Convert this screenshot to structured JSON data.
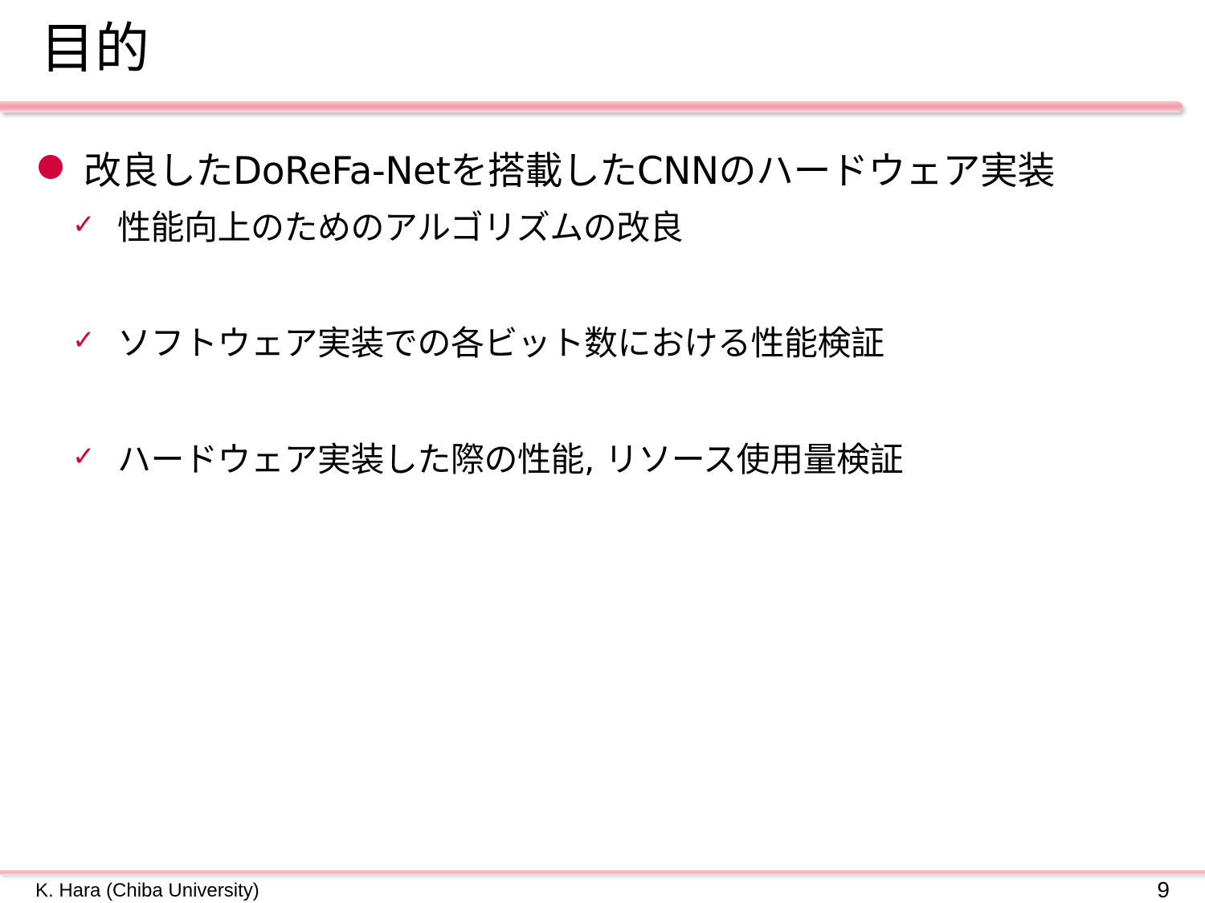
{
  "title": "目的",
  "colors": {
    "accent": "#d0043c",
    "rule": "#f19aa6"
  },
  "bullet": {
    "icon": "filled-circle-icon",
    "text": "改良したDoReFa-Netを搭載したCNNのハードウェア実装"
  },
  "subitems": [
    {
      "icon": "check-icon",
      "glyph": "✓",
      "text": "性能向上のためのアルゴリズムの改良"
    },
    {
      "icon": "check-icon",
      "glyph": "✓",
      "text": "ソフトウェア実装での各ビット数における性能検証"
    },
    {
      "icon": "check-icon",
      "glyph": "✓",
      "text": "ハードウェア実装した際の性能, リソース使用量検証"
    }
  ],
  "footer": {
    "author": "K. Hara (Chiba University)",
    "page_number": "9"
  }
}
